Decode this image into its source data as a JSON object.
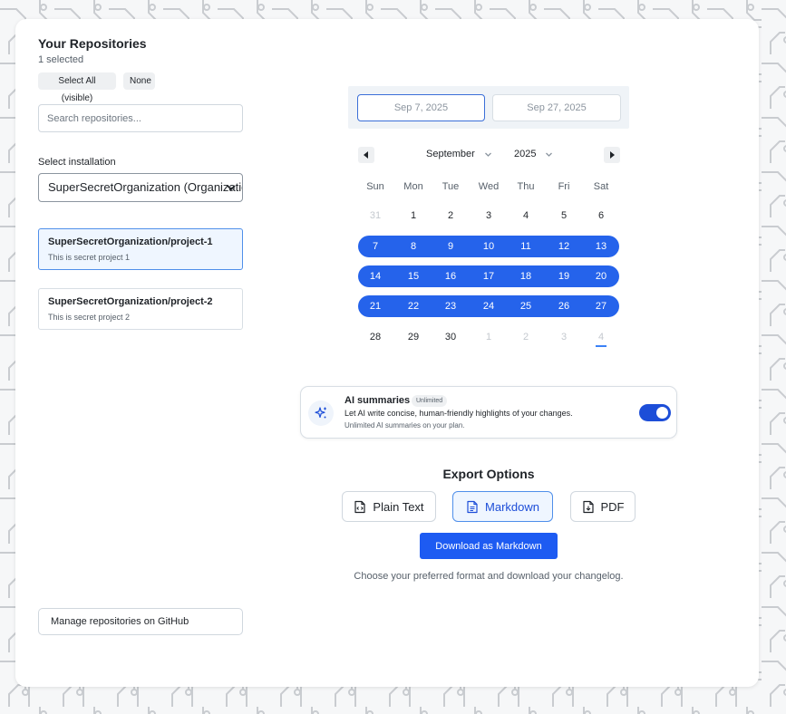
{
  "repositories": {
    "title": "Your Repositories",
    "selected_count": "1 selected",
    "select_all_label": "Select All (visible)",
    "none_label": "None",
    "search_placeholder": "Search repositories...",
    "installation_label": "Select installation",
    "installation_value": "SuperSecretOrganization (Organization)",
    "items": [
      {
        "name": "SuperSecretOrganization/project-1",
        "description": "This is secret project 1",
        "selected": true
      },
      {
        "name": "SuperSecretOrganization/project-2",
        "description": "This is secret project 2",
        "selected": false
      }
    ],
    "manage_label": "Manage repositories on GitHub"
  },
  "date_range": {
    "start": "Sep 7, 2025",
    "end": "Sep 27, 2025"
  },
  "calendar": {
    "month": "September",
    "year": "2025",
    "weekdays": [
      "Sun",
      "Mon",
      "Tue",
      "Wed",
      "Thu",
      "Fri",
      "Sat"
    ],
    "weeks": [
      [
        "31",
        "1",
        "2",
        "3",
        "4",
        "5",
        "6"
      ],
      [
        "7",
        "8",
        "9",
        "10",
        "11",
        "12",
        "13"
      ],
      [
        "14",
        "15",
        "16",
        "17",
        "18",
        "19",
        "20"
      ],
      [
        "21",
        "22",
        "23",
        "24",
        "25",
        "26",
        "27"
      ],
      [
        "28",
        "29",
        "30",
        "1",
        "2",
        "3",
        "4"
      ]
    ]
  },
  "ai_summaries": {
    "title": "AI summaries",
    "badge": "Unlimited",
    "description": "Let AI write concise, human-friendly highlights of your changes.",
    "note": "Unlimited AI summaries on your plan.",
    "enabled": true
  },
  "export": {
    "title": "Export Options",
    "formats": [
      "Plain Text",
      "Markdown",
      "PDF"
    ],
    "selected_format": "Markdown",
    "download_label": "Download as Markdown",
    "hint": "Choose your preferred format and download your changelog."
  },
  "colors": {
    "accent": "#2563eb",
    "primary_button": "#1d5bf2",
    "selected_bg": "#eff6ff"
  }
}
